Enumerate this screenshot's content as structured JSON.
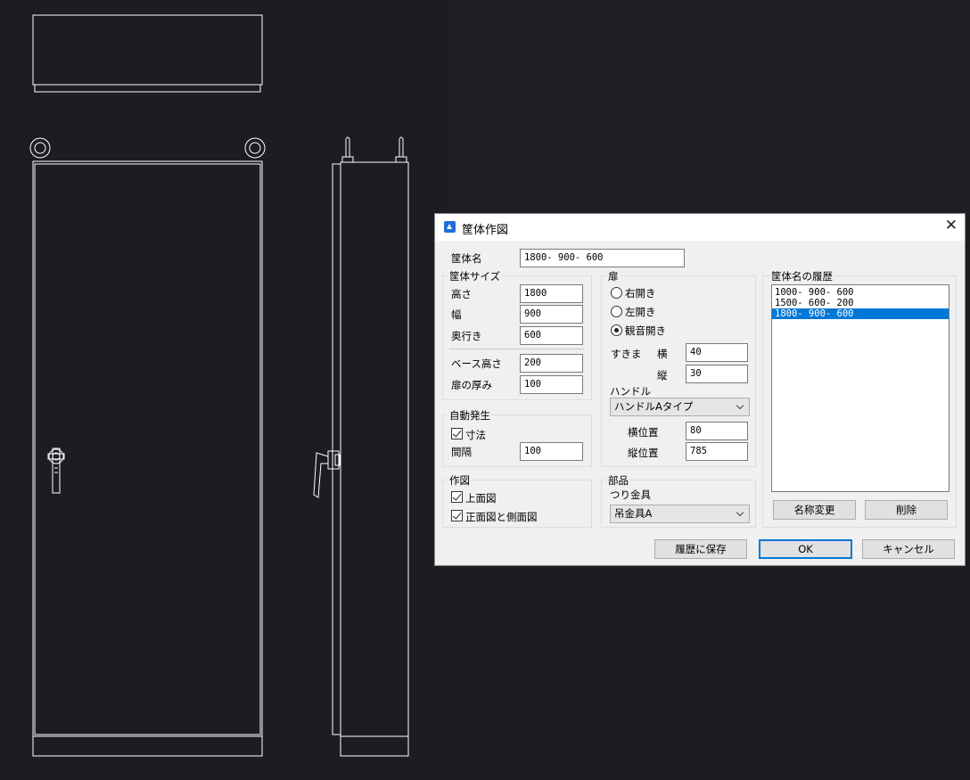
{
  "dialog": {
    "title": "筐体作図",
    "close_glyph": "✕",
    "name_label": "筐体名",
    "name_value": "1800- 900- 600",
    "size_group": {
      "legend": "筐体サイズ",
      "height_label": "高さ",
      "height_value": "1800",
      "width_label": "幅",
      "width_value": "900",
      "depth_label": "奥行き",
      "depth_value": "600",
      "base_label": "ベース高さ",
      "base_value": "200",
      "door_thickness_label": "扉の厚み",
      "door_thickness_value": "100"
    },
    "auto_group": {
      "legend": "自動発生",
      "dimension_label": "寸法",
      "dimension_checked": true,
      "interval_label": "間隔",
      "interval_value": "100"
    },
    "draw_group": {
      "legend": "作図",
      "top_view_label": "上面図",
      "top_view_checked": true,
      "front_side_label": "正面図と側面図",
      "front_side_checked": true
    },
    "door_group": {
      "legend": "扉",
      "options": [
        "右開き",
        "左開き",
        "観音開き"
      ],
      "selected": "観音開き",
      "gap_label": "すきま",
      "gap_h_label": "横",
      "gap_h_value": "40",
      "gap_v_label": "縦",
      "gap_v_value": "30",
      "handle_label": "ハンドル",
      "handle_select": "ハンドルAタイプ",
      "hpos_label": "横位置",
      "hpos_value": "80",
      "vpos_label": "縦位置",
      "vpos_value": "785"
    },
    "parts_group": {
      "legend": "部品",
      "hanger_label": "つり金具",
      "hanger_select": "吊金具A"
    },
    "history": {
      "legend": "筐体名の履歴",
      "items": [
        "1000- 900- 600",
        "1500- 600- 200",
        "1800- 900- 600"
      ],
      "selected_index": 2,
      "rename_button": "名称変更",
      "delete_button": "削除"
    },
    "buttons": {
      "save_history": "履歴に保存",
      "ok": "OK",
      "cancel": "キャンセル"
    }
  },
  "colors": {
    "cad_background": "#1b1d21",
    "cad_line": "#ffffff",
    "dialog_background": "#f0f0f0",
    "selection": "#0078d7"
  },
  "icons": [
    "app-icon",
    "close-icon",
    "chevron-down-icon"
  ]
}
